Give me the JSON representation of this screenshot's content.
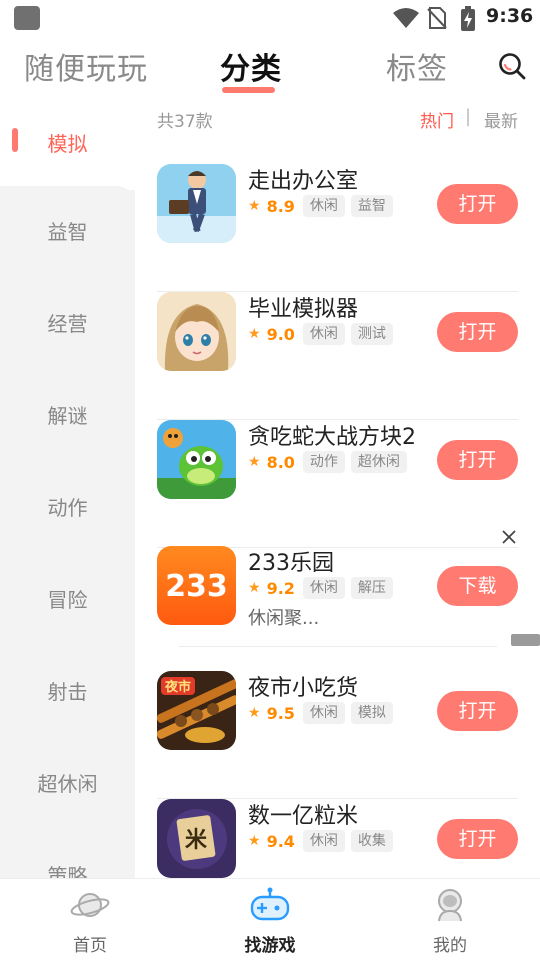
{
  "status_bar": {
    "time": "9:36"
  },
  "top_tabs": [
    {
      "label": "随便玩玩",
      "active": false
    },
    {
      "label": "分类",
      "active": true
    },
    {
      "label": "标签",
      "active": false
    }
  ],
  "sidebar": {
    "items": [
      {
        "label": "模拟",
        "active": true
      },
      {
        "label": "益智",
        "active": false
      },
      {
        "label": "经营",
        "active": false
      },
      {
        "label": "解谜",
        "active": false
      },
      {
        "label": "动作",
        "active": false
      },
      {
        "label": "冒险",
        "active": false
      },
      {
        "label": "射击",
        "active": false
      },
      {
        "label": "超休闲",
        "active": false
      },
      {
        "label": "策略",
        "active": false
      }
    ]
  },
  "list_header": {
    "count": "共37款",
    "sort_hot": "热门",
    "sort_separator": "|",
    "sort_new": "最新"
  },
  "games": [
    {
      "name": "走出办公室",
      "rating": "8.9",
      "tags": [
        "休闲",
        "益智"
      ],
      "action": "打开",
      "desc": ""
    },
    {
      "name": "毕业模拟器",
      "rating": "9.0",
      "tags": [
        "休闲",
        "测试"
      ],
      "action": "打开",
      "desc": ""
    },
    {
      "name": "贪吃蛇大战方块2",
      "rating": "8.0",
      "tags": [
        "动作",
        "超休闲"
      ],
      "action": "打开",
      "desc": ""
    },
    {
      "name": "233乐园",
      "rating": "9.2",
      "tags": [
        "休闲",
        "解压"
      ],
      "action": "下载",
      "desc": "休闲聚...",
      "icon_text": "233"
    },
    {
      "name": "夜市小吃货",
      "rating": "9.5",
      "tags": [
        "休闲",
        "模拟"
      ],
      "action": "打开",
      "desc": "",
      "icon_text": "夜市"
    },
    {
      "name": "数一亿粒米",
      "rating": "9.4",
      "tags": [
        "休闲",
        "收集"
      ],
      "action": "打开",
      "desc": "",
      "icon_text": "米"
    }
  ],
  "bottom_nav": [
    {
      "label": "首页",
      "icon": "planet-icon",
      "active": false
    },
    {
      "label": "找游戏",
      "icon": "gamepad-icon",
      "active": true
    },
    {
      "label": "我的",
      "icon": "astronaut-icon",
      "active": false
    }
  ],
  "colors": {
    "accent": "#ff7a70",
    "accent_text": "#ff5a4b",
    "rating": "#ff8a00",
    "sidebar_bg": "#f3f3f3",
    "nav_active_icon": "#2a9cff"
  }
}
